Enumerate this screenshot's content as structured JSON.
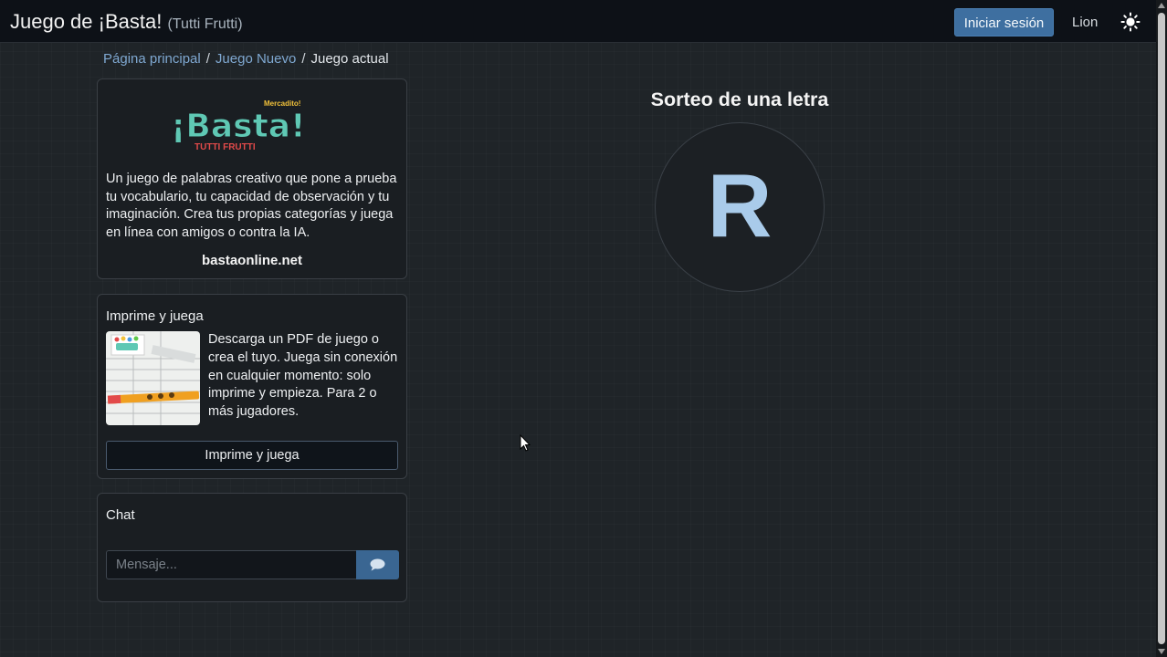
{
  "header": {
    "title": "Juego de ¡Basta!",
    "subtitle": "(Tutti Frutti)",
    "login_label": "Iniciar sesión",
    "language": "Lion",
    "theme_icon": "sun-icon"
  },
  "breadcrumb": {
    "items": [
      "Página principal",
      "Juego Nuevo"
    ],
    "current": "Juego actual"
  },
  "intro_card": {
    "logo_top": "Mercadito!",
    "logo_main": "¡Basta!",
    "logo_sub": "TUTTI FRUTTI",
    "description": "Un juego de palabras creativo que pone a prueba tu vocabulario, tu capacidad de observación y tu imaginación. Crea tus propias categorías y juega en línea con amigos o contra la IA.",
    "site": "bastaonline.net"
  },
  "print_card": {
    "title": "Imprime y juega",
    "description": "Descarga un PDF de juego o crea el tuyo. Juega sin conexión en cualquier momento: solo imprime y empieza. Para 2 o más jugadores.",
    "button_label": "Imprime y juega"
  },
  "chat": {
    "title": "Chat",
    "placeholder": "Mensaje...",
    "send_icon": "comment-icon"
  },
  "draw": {
    "title": "Sorteo de una letra",
    "letter": "R"
  },
  "colors": {
    "background": "#1f2428",
    "navbar": "#0d1117",
    "accent": "#3e6fa0",
    "link": "#7fa8d1",
    "letter": "#a9cbea"
  }
}
